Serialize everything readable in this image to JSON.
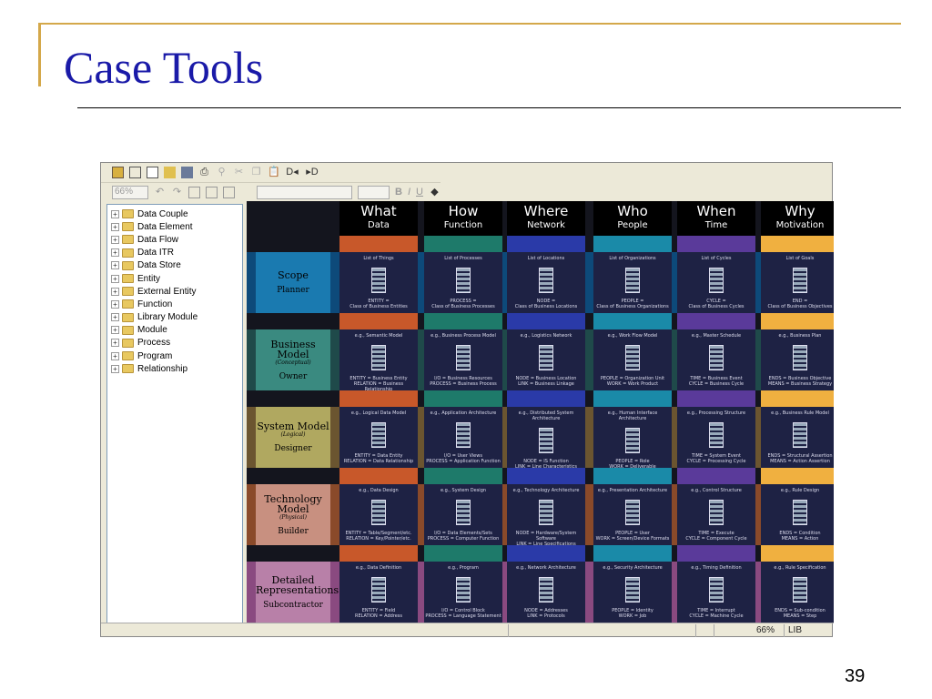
{
  "slide": {
    "title": "Case Tools",
    "page_number": "39"
  },
  "toolbar": {
    "zoom_value": "66%",
    "bold": "B",
    "italic": "I",
    "underline": "U"
  },
  "tree": [
    "Data Couple",
    "Data Element",
    "Data Flow",
    "Data ITR",
    "Data Store",
    "Entity",
    "External Entity",
    "Function",
    "Library Module",
    "Module",
    "Process",
    "Program",
    "Relationship"
  ],
  "columns": [
    {
      "title": "What",
      "sub": "Data",
      "color": "#c8582a"
    },
    {
      "title": "How",
      "sub": "Function",
      "color": "#1e7a6a"
    },
    {
      "title": "Where",
      "sub": "Network",
      "color": "#2a3aa8"
    },
    {
      "title": "Who",
      "sub": "People",
      "color": "#1a8aa8"
    },
    {
      "title": "When",
      "sub": "Time",
      "color": "#5a3a9a"
    },
    {
      "title": "Why",
      "sub": "Motivation",
      "color": "#f0b040"
    }
  ],
  "rows": [
    {
      "name": "Scope",
      "sub": "",
      "owner": "Planner",
      "band": "#0d4a7a",
      "label_bg": "#1a7ab0",
      "cells": [
        [
          "List of Things",
          "ENTITY =",
          "Class of Business Entities"
        ],
        [
          "List of Processes",
          "PROCESS =",
          "Class of Business Processes"
        ],
        [
          "List of Locations",
          "NODE =",
          "Class of Business Locations"
        ],
        [
          "List of Organizations",
          "PEOPLE =",
          "Class of Business Organizations"
        ],
        [
          "List of Cycles",
          "CYCLE =",
          "Class of Business Cycles"
        ],
        [
          "List of Goals",
          "END =",
          "Class of Business Objectives"
        ]
      ]
    },
    {
      "name": "Business Model",
      "sub": "(Conceptual)",
      "owner": "Owner",
      "band": "#1f4a4a",
      "label_bg": "#3a8a80",
      "cells": [
        [
          "e.g., Semantic Model",
          "ENTITY = Business Entity",
          "RELATION = Business Relationship"
        ],
        [
          "e.g., Business Process Model",
          "I/O = Business Resources",
          "PROCESS = Business Process"
        ],
        [
          "e.g., Logistics Network",
          "NODE = Business Location",
          "LINK = Business Linkage"
        ],
        [
          "e.g., Work Flow Model",
          "PEOPLE = Organization Unit",
          "WORK = Work Product"
        ],
        [
          "e.g., Master Schedule",
          "TIME = Business Event",
          "CYCLE = Business Cycle"
        ],
        [
          "e.g., Business Plan",
          "ENDS = Business Objective",
          "MEANS = Business Strategy"
        ]
      ]
    },
    {
      "name": "System Model",
      "sub": "(Logical)",
      "owner": "Designer",
      "band": "#6b5530",
      "label_bg": "#b0a860",
      "cells": [
        [
          "e.g., Logical Data Model",
          "ENTITY = Data Entity",
          "RELATION = Data Relationship"
        ],
        [
          "e.g., Application Architecture",
          "I/O = User Views",
          "PROCESS = Application Function"
        ],
        [
          "e.g., Distributed System Architecture",
          "NODE = IS Function",
          "LINK = Line Characteristics"
        ],
        [
          "e.g., Human Interface Architecture",
          "PEOPLE = Role",
          "WORK = Deliverable"
        ],
        [
          "e.g., Processing Structure",
          "TIME = System Event",
          "CYCLE = Processing Cycle"
        ],
        [
          "e.g., Business Rule Model",
          "ENDS = Structural Assertion",
          "MEANS = Action Assertion"
        ]
      ]
    },
    {
      "name": "Technology Model",
      "sub": "(Physical)",
      "owner": "Builder",
      "band": "#8a4a2a",
      "label_bg": "#c89080",
      "cells": [
        [
          "e.g., Data Design",
          "ENTITY = Table/Segment/etc.",
          "RELATION = Key/Pointer/etc."
        ],
        [
          "e.g., System Design",
          "I/O = Data Elements/Sets",
          "PROCESS = Computer Function"
        ],
        [
          "e.g., Technology Architecture",
          "NODE = Hardware/System Software",
          "LINK = Line Specifications"
        ],
        [
          "e.g., Presentation Architecture",
          "PEOPLE = User",
          "WORK = Screen/Device Formats"
        ],
        [
          "e.g., Control Structure",
          "TIME = Execute",
          "CYCLE = Component Cycle"
        ],
        [
          "e.g., Rule Design",
          "ENDS = Condition",
          "MEANS = Action"
        ]
      ]
    },
    {
      "name": "Detailed Representations",
      "sub": "",
      "owner": "Subcontractor",
      "band": "#8a4a80",
      "label_bg": "#b880a8",
      "cells": [
        [
          "e.g., Data Definition",
          "ENTITY = Field",
          "RELATION = Address"
        ],
        [
          "e.g., Program",
          "I/O = Control Block",
          "PROCESS = Language Statement"
        ],
        [
          "e.g., Network Architecture",
          "NODE = Addresses",
          "LINK = Protocols"
        ],
        [
          "e.g., Security Architecture",
          "PEOPLE = Identity",
          "WORK = Job"
        ],
        [
          "e.g., Timing Definition",
          "TIME = Interrupt",
          "CYCLE = Machine Cycle"
        ],
        [
          "e.g., Rule Specification",
          "ENDS = Sub-condition",
          "MEANS = Step"
        ]
      ]
    }
  ],
  "status": {
    "zoom": "66%",
    "mode": "LIB"
  }
}
